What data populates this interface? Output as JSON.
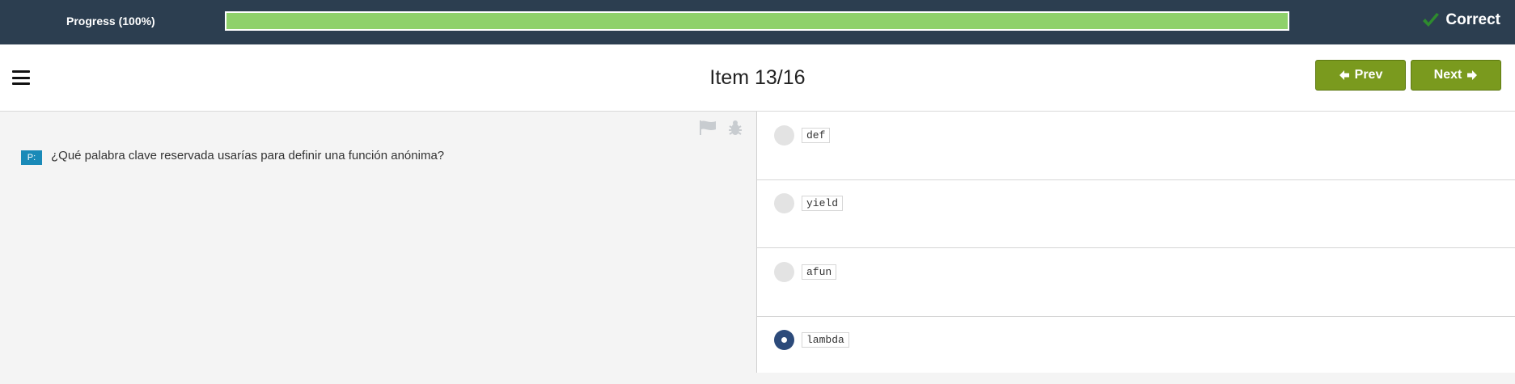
{
  "topbar": {
    "progress_label": "Progress (100%)",
    "progress_value": 1.0,
    "status_text": "Correct",
    "status_icon": "checkmark-icon",
    "progress_color": "#8fd16b",
    "status_icon_color": "#2e8b2e"
  },
  "header": {
    "item_title": "Item 13/16",
    "prev_label": "Prev",
    "next_label": "Next",
    "menu_icon": "hamburger-menu-icon",
    "button_color": "#7a9a1e"
  },
  "question": {
    "badge": "P:",
    "text": "¿Qué palabra clave reservada usarías para definir una función anónima?",
    "tools": [
      "flag-icon",
      "bug-icon"
    ]
  },
  "options": [
    {
      "label": "def",
      "selected": false
    },
    {
      "label": "yield",
      "selected": false
    },
    {
      "label": "afun",
      "selected": false
    },
    {
      "label": "lambda",
      "selected": true
    }
  ]
}
